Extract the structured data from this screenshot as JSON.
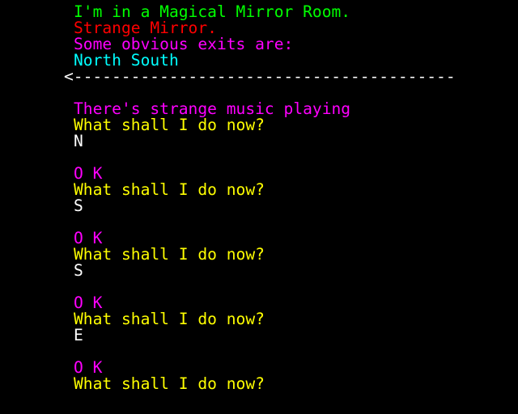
{
  "room": {
    "title": "I'm in a Magical Mirror Room.",
    "item": "Strange Mirror.",
    "exits_heading": "Some obvious exits are:",
    "exits": "North South"
  },
  "divider": "<---------------------------------------->",
  "log": [
    {
      "text": "There's strange music playing",
      "color": "magenta"
    },
    {
      "text": "What shall I do now?",
      "color": "yellow"
    },
    {
      "text": "N",
      "color": "white"
    },
    {
      "text": "",
      "color": "white"
    },
    {
      "text": "O K",
      "color": "magenta"
    },
    {
      "text": "What shall I do now?",
      "color": "yellow"
    },
    {
      "text": "S",
      "color": "white"
    },
    {
      "text": "",
      "color": "white"
    },
    {
      "text": "O K",
      "color": "magenta"
    },
    {
      "text": "What shall I do now?",
      "color": "yellow"
    },
    {
      "text": "S",
      "color": "white"
    },
    {
      "text": "",
      "color": "white"
    },
    {
      "text": "O K",
      "color": "magenta"
    },
    {
      "text": "What shall I do now?",
      "color": "yellow"
    },
    {
      "text": "E",
      "color": "white"
    },
    {
      "text": "",
      "color": "white"
    },
    {
      "text": "O K",
      "color": "magenta"
    },
    {
      "text": "What shall I do now?",
      "color": "yellow"
    }
  ],
  "colors": {
    "green": "#00ff00",
    "red": "#ff0000",
    "magenta": "#ff00ff",
    "cyan": "#00ffff",
    "yellow": "#ffff00",
    "white": "#ffffff"
  }
}
